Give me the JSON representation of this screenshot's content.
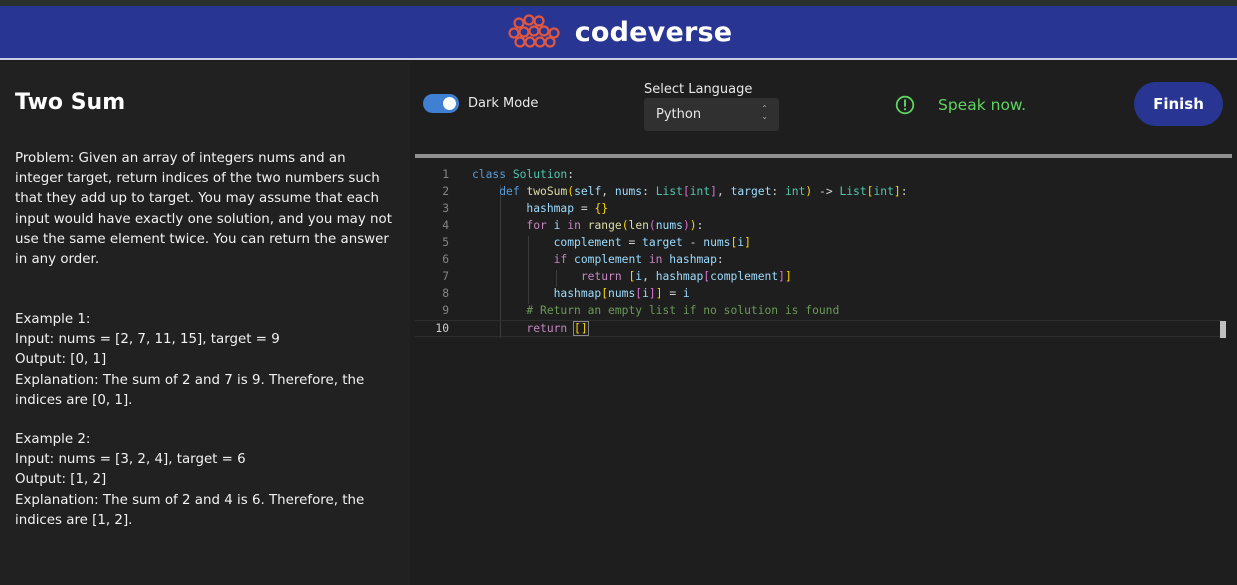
{
  "header": {
    "brand_name": "codeverse"
  },
  "problem": {
    "title": "Two Sum",
    "statement": "Problem: Given an array of integers nums and an integer target, return indices of the two numbers such that they add up to target. You may assume that each input would have exactly one solution, and you may not use the same element twice. You can return the answer in any order.",
    "examples": [
      {
        "heading": "Example 1:",
        "input": "Input: nums = [2, 7, 11, 15], target = 9",
        "output": "Output: [0, 1]",
        "explanation": "Explanation: The sum of 2 and 7 is 9. Therefore, the indices are [0, 1]."
      },
      {
        "heading": "Example 2:",
        "input": "Input: nums = [3, 2, 4], target = 6",
        "output": "Output: [1, 2]",
        "explanation": "Explanation: The sum of 2 and 4 is 6. Therefore, the indices are [1, 2]."
      }
    ]
  },
  "toolbar": {
    "dark_mode_label": "Dark Mode",
    "dark_mode_on": true,
    "language_label": "Select Language",
    "language_value": "Python",
    "status_text": "Speak now.",
    "status_icon": "alert-circle-icon",
    "finish_label": "Finish"
  },
  "colors": {
    "header_bg": "#283593",
    "accent_blue": "#3f7fd4",
    "status_green": "#5fd35f"
  },
  "editor": {
    "active_line": 10,
    "lines": [
      "class Solution:",
      "    def twoSum(self, nums: List[int], target: int) -> List[int]:",
      "        hashmap = {}",
      "        for i in range(len(nums)):",
      "            complement = target - nums[i]",
      "            if complement in hashmap:",
      "                return [i, hashmap[complement]]",
      "            hashmap[nums[i]] = i",
      "        # Return an empty list if no solution is found",
      "        return []"
    ]
  }
}
